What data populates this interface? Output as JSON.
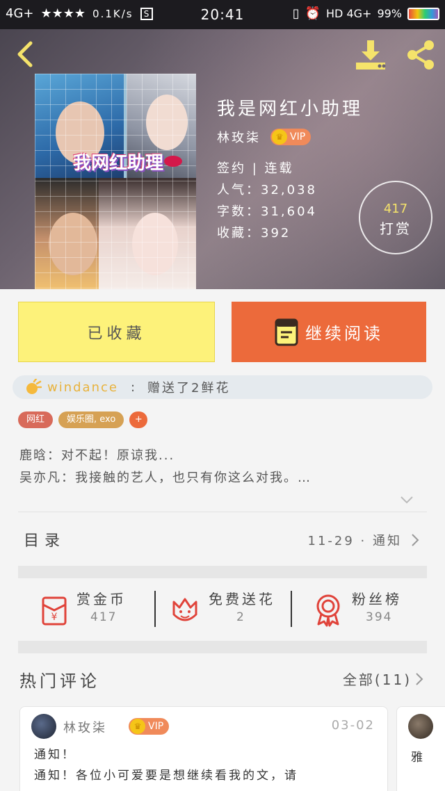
{
  "status_bar": {
    "network_left": "4G+",
    "signal_stars": "★★★★",
    "speed": "0.1K/s",
    "s_icon": "S",
    "time": "20:41",
    "network_right": "HD 4G+",
    "battery_pct": "99%"
  },
  "book": {
    "title": "我是网红小助理",
    "author": "林玫柒",
    "vip_label": "VIP",
    "status_line": "签约 | 连载",
    "popularity": "人气：32,038",
    "word_count": "字数：31,604",
    "favorites": "收藏：392",
    "cover_text": "我网红助理",
    "reward": {
      "count": "417",
      "label": "打赏"
    }
  },
  "actions": {
    "collected_label": "已收藏",
    "read_label": "继续阅读"
  },
  "gift": {
    "user": "windance",
    "colon": ":",
    "text": "赠送了2鲜花"
  },
  "tags": [
    {
      "label": "网红"
    },
    {
      "label": "娱乐圈, exo"
    },
    {
      "label": "+"
    }
  ],
  "summary": {
    "line1": "鹿晗：对不起！原谅我...",
    "line2": "吴亦凡：我接触的艺人，也只有你这么对我。…"
  },
  "catalog": {
    "title": "目录",
    "latest": "11-29 · 通知"
  },
  "stats": {
    "coin": {
      "label": "赏金币",
      "value": "417"
    },
    "flower": {
      "label": "免费送花",
      "value": "2"
    },
    "fans": {
      "label": "粉丝榜",
      "value": "394"
    }
  },
  "hot_comments": {
    "title": "热门评论",
    "all_label": "全部(11)",
    "items": [
      {
        "name": "林玫柒",
        "vip": "VIP",
        "date": "03-02",
        "line1": "通知！",
        "line2": "通知！各位小可爱要是想继续看我的文，请"
      },
      {
        "snippet": "雅"
      }
    ]
  },
  "colors": {
    "accent_orange": "#ec6a3b",
    "collected_yellow": "#fdf27a",
    "icon_red": "#e0433a",
    "header_icon_yellow": "#f5e36b"
  }
}
